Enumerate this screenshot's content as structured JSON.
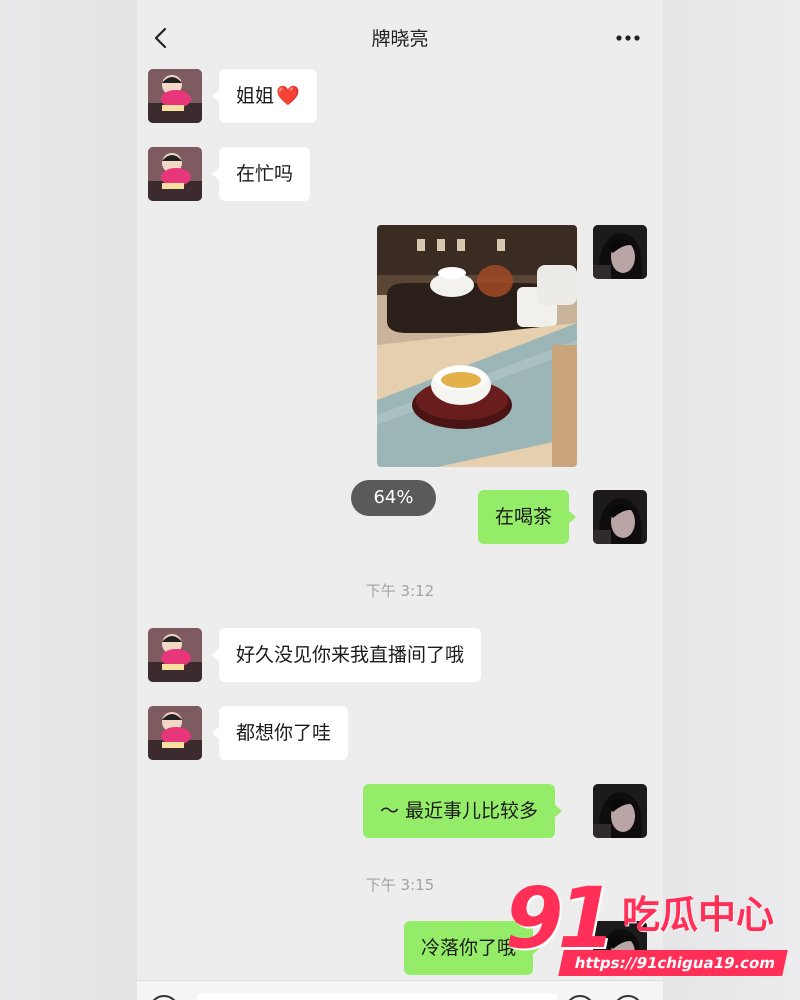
{
  "header": {
    "title": "牌晓亮"
  },
  "icons": {
    "back": "chevron-left-icon",
    "more": "more-horizontal-icon",
    "heart": "heart-emoji"
  },
  "colors": {
    "background": "#ededed",
    "bubble_other": "#ffffff",
    "bubble_self": "#95ec69",
    "timestamp_text": "#a3a3a3",
    "watermark_red": "#ff2f57"
  },
  "messages": [
    {
      "from": "other",
      "text": "姐姐",
      "emoji": "❤️"
    },
    {
      "from": "other",
      "text": "在忙吗"
    },
    {
      "from": "self",
      "type": "image",
      "alt": "tea-cup-photo",
      "upload_progress": "64%"
    },
    {
      "from": "self",
      "text": "在喝茶"
    },
    {
      "type": "timestamp",
      "text": "下午 3:12"
    },
    {
      "from": "other",
      "text": "好久没见你来我直播间了哦"
    },
    {
      "from": "other",
      "text": "都想你了哇"
    },
    {
      "from": "self",
      "text": "～ 最近事儿比较多"
    },
    {
      "type": "timestamp",
      "text": "下午 3:15"
    },
    {
      "from": "self",
      "text": "冷落你了哦"
    }
  ],
  "watermark": {
    "number": "91",
    "name": "吃瓜中心",
    "url": "https://91chigua19.com"
  }
}
